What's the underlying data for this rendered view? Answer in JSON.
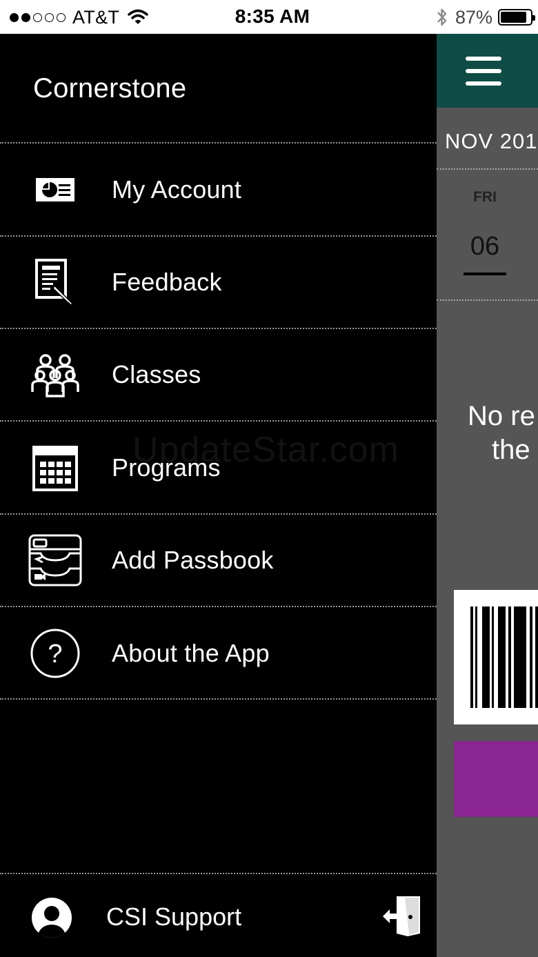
{
  "status_bar": {
    "carrier": "AT&T",
    "time": "8:35 AM",
    "battery_percent": "87%",
    "battery_level": 0.87,
    "signal_bars_filled": 2,
    "signal_bars_total": 5
  },
  "menu": {
    "brand": "Cornerstone",
    "items": [
      {
        "label": "My Account",
        "icon": "account-card-icon"
      },
      {
        "label": "Feedback",
        "icon": "feedback-form-icon"
      },
      {
        "label": "Classes",
        "icon": "group-people-icon"
      },
      {
        "label": "Programs",
        "icon": "calendar-icon"
      },
      {
        "label": "Add Passbook",
        "icon": "passbook-wallet-icon"
      },
      {
        "label": "About the App",
        "icon": "question-circle-icon"
      }
    ],
    "user": {
      "name": "CSI Support",
      "icon": "user-avatar-icon"
    },
    "logout_icon": "logout-door-icon"
  },
  "background_screen": {
    "header_color": "#0f4c45",
    "month": "NOV 201",
    "day_label": "FRI",
    "date": "06",
    "message_line1": "No re",
    "message_line2": "the",
    "button_color": "#8b2592"
  },
  "watermark": "UpdateStar.com"
}
